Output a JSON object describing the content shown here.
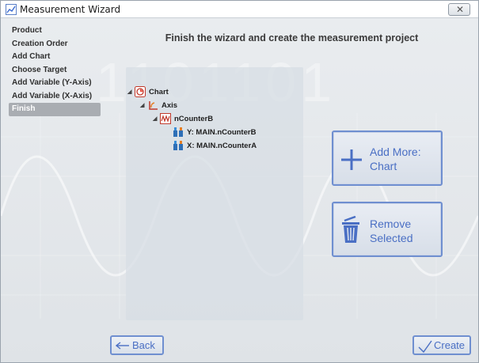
{
  "window": {
    "title": "Measurement Wizard",
    "close_glyph": "✕"
  },
  "sidebar": {
    "items": [
      {
        "label": "Product",
        "active": false
      },
      {
        "label": "Creation Order",
        "active": false
      },
      {
        "label": "Add Chart",
        "active": false
      },
      {
        "label": "Choose Target",
        "active": false
      },
      {
        "label": "Add Variable (Y-Axis)",
        "active": false
      },
      {
        "label": "Add Variable (X-Axis)",
        "active": false
      },
      {
        "label": "Finish",
        "active": true
      }
    ]
  },
  "main": {
    "heading": "Finish the wizard and create the measurement project",
    "tree": [
      {
        "label": "Chart",
        "icon": "chart-node-icon",
        "expanded": true
      },
      {
        "label": "Axis",
        "icon": "axis-node-icon",
        "expanded": true
      },
      {
        "label": "nCounterB",
        "icon": "signal-node-icon",
        "expanded": true
      },
      {
        "label": "Y: MAIN.nCounterB",
        "icon": "variable-icon"
      },
      {
        "label": "X: MAIN.nCounterA",
        "icon": "variable-icon"
      }
    ],
    "add_more": {
      "line1": "Add More:",
      "line2": "Chart"
    },
    "remove": {
      "line1": "Remove",
      "line2": "Selected"
    }
  },
  "footer": {
    "back_label": "Back",
    "create_label": "Create"
  },
  "colors": {
    "accent": "#4a6fc4",
    "accent_border": "#6f8fd0",
    "active_item": "#a9adb2"
  },
  "background_text": "1101101"
}
